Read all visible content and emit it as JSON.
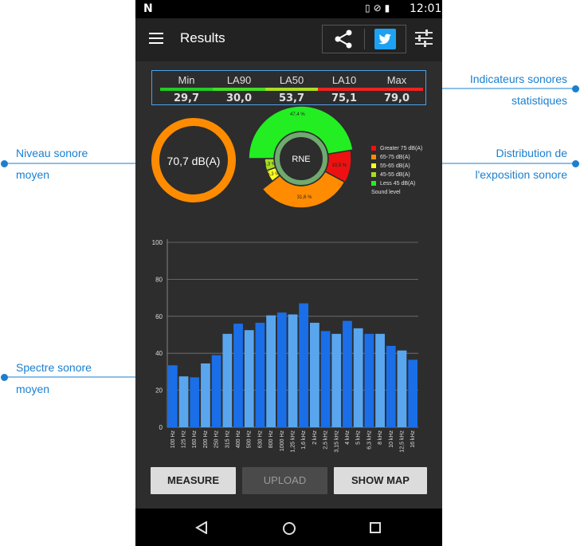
{
  "status_bar": {
    "time": "12:01",
    "notification_icon": "N"
  },
  "app_bar": {
    "title": "Results",
    "icons": [
      "menu-icon",
      "share-icon",
      "twitter-icon",
      "equalizer-icon"
    ]
  },
  "stats": [
    {
      "label": "Min",
      "value": "29,7",
      "color": "#22cc22"
    },
    {
      "label": "LA90",
      "value": "30,0",
      "color": "#33dd22"
    },
    {
      "label": "LA50",
      "value": "53,7",
      "color": "#aadd22"
    },
    {
      "label": "LA10",
      "value": "75,1",
      "color": "#ee2222"
    },
    {
      "label": "Max",
      "value": "79,0",
      "color": "#ee2222"
    }
  ],
  "average_level": "70,7 dB(A)",
  "distribution": {
    "center_label": "RNE",
    "slices": [
      {
        "label": "47,4 %",
        "value": 47.4,
        "color": "#22ee22"
      },
      {
        "label": "10,5 %",
        "value": 10.5,
        "color": "#ee1111"
      },
      {
        "label": "31,6 %",
        "value": 31.6,
        "color": "#ff8c00"
      },
      {
        "label": "5,3 %",
        "value": 5.3,
        "color": "#ffff22"
      },
      {
        "label": "5,3 %",
        "value": 5.3,
        "color": "#aadd22"
      }
    ],
    "legend": [
      {
        "label": "Greater 75 dB(A)",
        "color": "#ee1111"
      },
      {
        "label": "65-75 dB(A)",
        "color": "#ff8c00"
      },
      {
        "label": "55-65 dB(A)",
        "color": "#ffff22"
      },
      {
        "label": "45-55 dB(A)",
        "color": "#aadd22"
      },
      {
        "label": "Less 45 dB(A)",
        "color": "#22ee22"
      }
    ],
    "legend_title": "Sound level"
  },
  "chart_data": {
    "type": "bar",
    "categories": [
      "100 Hz",
      "125 Hz",
      "160 Hz",
      "200 Hz",
      "250 Hz",
      "315 Hz",
      "400 Hz",
      "500 Hz",
      "630 Hz",
      "800 Hz",
      "1000 Hz",
      "1,25 kHz",
      "1,6 kHz",
      "2 kHz",
      "2,5 kHz",
      "3,15 kHz",
      "4 kHz",
      "5 kHz",
      "6,3 kHz",
      "8 kHz",
      "10 kHz",
      "12,5 kHz",
      "16 kHz"
    ],
    "values": [
      33.5,
      27.5,
      27,
      34.5,
      39,
      50.5,
      56,
      52.5,
      56.5,
      60.5,
      62,
      61,
      67,
      56.5,
      52,
      50.5,
      57.5,
      53.5,
      50.5,
      50.5,
      44,
      41.5,
      36.5
    ],
    "ylim": [
      0,
      100
    ],
    "yticks": [
      0,
      20,
      40,
      60,
      80,
      100
    ],
    "colors": {
      "dark": "#1a6ee8",
      "light": "#5aa6ee"
    },
    "grid": true
  },
  "buttons": {
    "measure": "MEASURE",
    "upload": "UPLOAD",
    "show_map": "SHOW MAP"
  },
  "annotations": {
    "indicators": "Indicateurs sonores statistiques",
    "average": "Niveau sonore moyen",
    "distribution": "Distribution de l'exposition sonore",
    "spectrum": "Spectre sonore moyen"
  },
  "annotation_color": "#1a7fd0"
}
